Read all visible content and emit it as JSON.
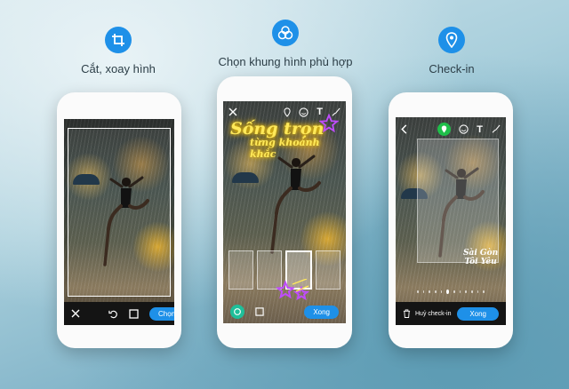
{
  "features": [
    {
      "label": "Cắt, xoay hình",
      "icon": "crop-icon"
    },
    {
      "label": "Chọn khung hình phù hợp",
      "icon": "frames-icon"
    },
    {
      "label": "Check-in",
      "icon": "location-pin-icon"
    }
  ],
  "phone1": {
    "bottom_bar": {
      "close_icon": "close-icon",
      "rotate_icon": "rotate-icon",
      "aspect_icon": "aspect-ratio-icon",
      "choose_label": "Chọn"
    }
  },
  "phone2": {
    "toolbar": {
      "close_icon": "close-icon",
      "location_icon": "location-pin-icon",
      "emoji_icon": "emoji-icon",
      "text_icon": "T",
      "draw_icon": "brush-icon"
    },
    "neon_line1": "Sống trọn",
    "neon_line2": "từng khoảnh khắc",
    "done_label": "Xong",
    "colors": {
      "neon": "#ffe95a",
      "star": "#c04cff",
      "accent": "#1e90e8"
    }
  },
  "phone3": {
    "toolbar": {
      "back_icon": "back-arrow-icon",
      "location_icon": "location-pin-icon",
      "emoji_icon": "emoji-icon",
      "text_icon": "T",
      "draw_icon": "brush-icon"
    },
    "sticker_line1": "Sài Gòn",
    "sticker_line2": "Tôi Yêu",
    "cancel_label": "Huỷ check-in",
    "done_label": "Xong"
  }
}
